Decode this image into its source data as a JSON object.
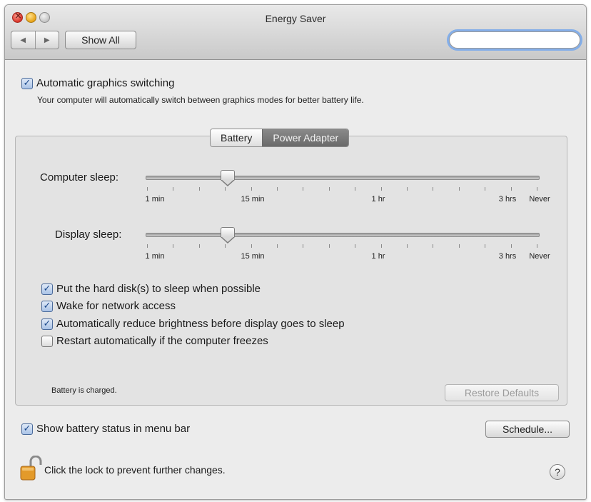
{
  "window": {
    "title": "Energy Saver"
  },
  "toolbar": {
    "back_icon": "◀",
    "forward_icon": "▶",
    "show_all_label": "Show All",
    "search": {
      "value": "",
      "placeholder": ""
    }
  },
  "graphics_switching": {
    "label": "Automatic graphics switching",
    "checked": true,
    "description": "Your computer will automatically switch between graphics modes for better battery life."
  },
  "tabs": [
    {
      "label": "Battery",
      "active": false
    },
    {
      "label": "Power Adapter",
      "active": true
    }
  ],
  "sliders": {
    "computer_sleep": {
      "label": "Computer sleep:",
      "value_label": "15 min",
      "tick_labels": [
        "1 min",
        "15 min",
        "1 hr",
        "3 hrs",
        "Never"
      ]
    },
    "display_sleep": {
      "label": "Display sleep:",
      "value_label": "15 min",
      "tick_labels": [
        "1 min",
        "15 min",
        "1 hr",
        "3 hrs",
        "Never"
      ]
    }
  },
  "options": [
    {
      "label": "Put the hard disk(s) to sleep when possible",
      "checked": true
    },
    {
      "label": "Wake for network access",
      "checked": true
    },
    {
      "label": "Automatically reduce brightness before display goes to sleep",
      "checked": true
    },
    {
      "label": "Restart automatically if the computer freezes",
      "checked": false
    }
  ],
  "status_text": "Battery is charged.",
  "restore_defaults_label": "Restore Defaults",
  "show_battery_status": {
    "label": "Show battery status in menu bar",
    "checked": true
  },
  "schedule_label": "Schedule...",
  "lock_text": "Click the lock to prevent further changes.",
  "help_label": "?",
  "colors": {
    "search_focus": "#84aee8",
    "active_tab": "#6a6a6a"
  }
}
